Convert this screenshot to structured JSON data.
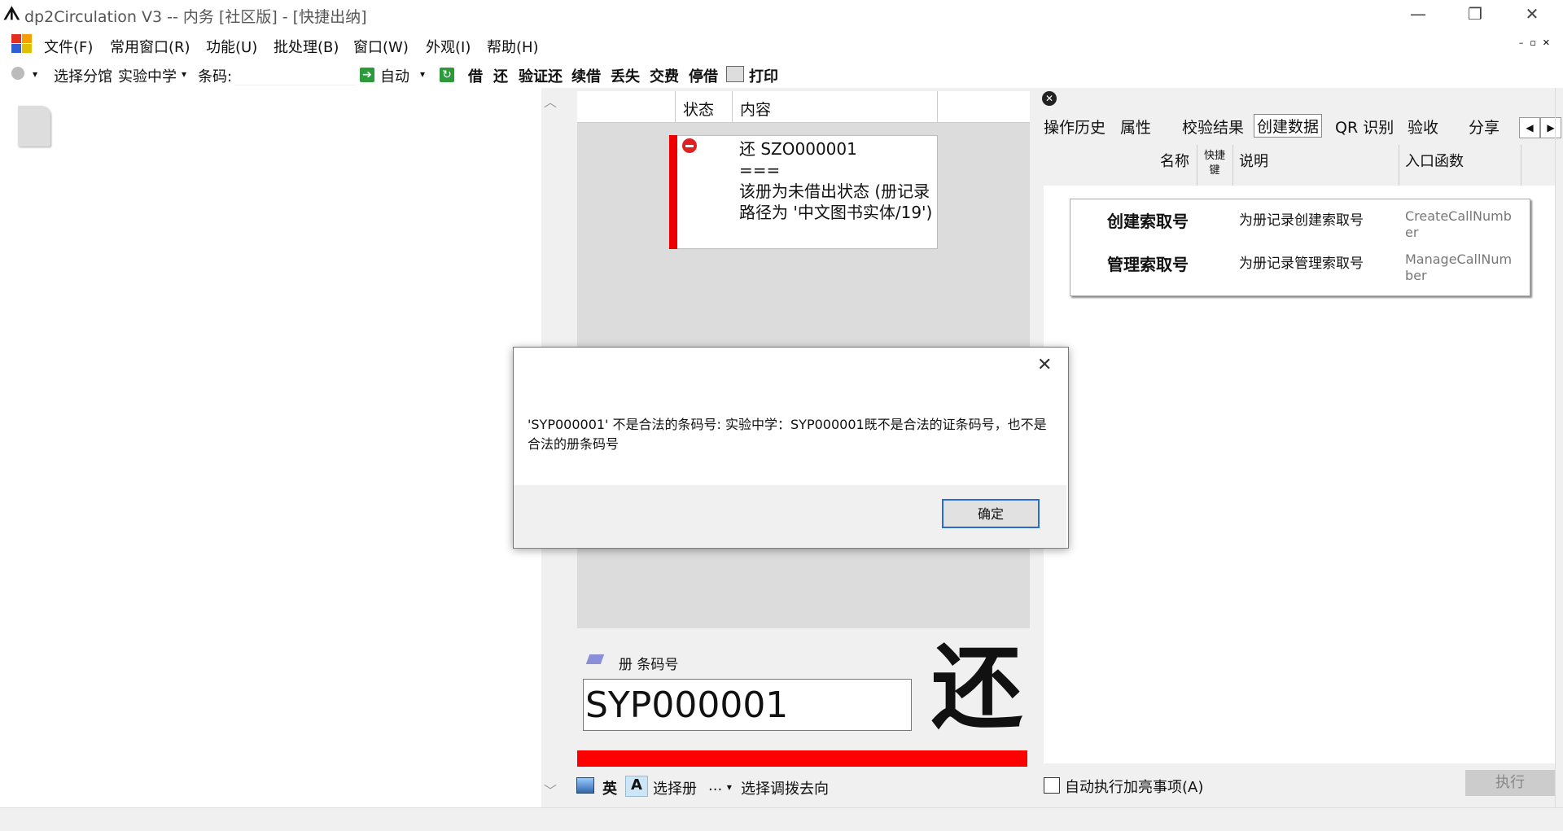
{
  "window": {
    "logo": "ᗑ",
    "title": "dp2Circulation V3 -- 内务 [社区版] - [快捷出纳]",
    "minimize": "—",
    "restore": "❐",
    "close": "✕"
  },
  "menu": [
    "文件(F)",
    "常用窗口(R)",
    "功能(U)",
    "批处理(B)",
    "窗口(W)",
    "外观(I)",
    "帮助(H)"
  ],
  "mdi_controls": "–▫✕",
  "toolbar": {
    "branch_prefix": "选择分馆",
    "branch_value": "实验中学",
    "barcode_label": "条码:",
    "auto": "自动",
    "actions": [
      "借",
      "还",
      "验证还",
      "续借",
      "丢失",
      "交费",
      "停借"
    ],
    "print": "打印"
  },
  "list": {
    "columns": [
      "状态",
      "内容"
    ],
    "result_lines": [
      "还 SZO000001",
      "===",
      "该册为未借出状态 (册记录路径为 '中文图书实体/19')"
    ]
  },
  "input": {
    "label": "册 条码号",
    "value": "SYP000001",
    "mode": "还"
  },
  "bottom": {
    "lang": "英",
    "font": "A",
    "select_volume": "选择册",
    "dots": "...",
    "select_transfer": "选择调拨去向"
  },
  "right": {
    "tabs": [
      "操作历史",
      "属性",
      "校验结果",
      "创建数据",
      "QR 识别",
      "验收",
      "分享"
    ],
    "active_tab": "创建数据",
    "nav_left": "◀",
    "nav_right": "▶",
    "columns": {
      "name": "名称",
      "shortcut": "快捷键",
      "desc": "说明",
      "entry": "入口函数"
    },
    "rows": [
      {
        "name": "创建索取号",
        "desc": "为册记录创建索取号",
        "fn": "CreateCallNumber"
      },
      {
        "name": "管理索取号",
        "desc": "为册记录管理索取号",
        "fn": "ManageCallNumber"
      }
    ],
    "auto_exec": "自动执行加亮事项(A)",
    "exec": "执行"
  },
  "dialog": {
    "message": "'SYP000001' 不是合法的条码号: 实验中学：SYP000001既不是合法的证条码号，也不是合法的册条码号",
    "ok": "确定",
    "close": "✕"
  }
}
